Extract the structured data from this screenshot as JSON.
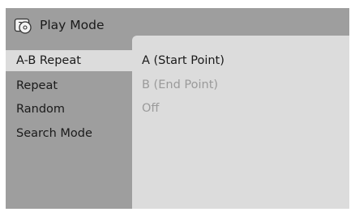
{
  "header": {
    "title": "Play Mode",
    "icon": "disc-icon"
  },
  "sidebar": {
    "items": [
      {
        "label": "A-B Repeat",
        "selected": true
      },
      {
        "label": "Repeat",
        "selected": false
      },
      {
        "label": "Random",
        "selected": false
      },
      {
        "label": "Search Mode",
        "selected": false
      }
    ]
  },
  "options": {
    "items": [
      {
        "label": "A (Start Point)",
        "enabled": true
      },
      {
        "label": "B (End Point)",
        "enabled": false
      },
      {
        "label": "Off",
        "enabled": false
      }
    ]
  },
  "colors": {
    "panel": "#9e9e9e",
    "content": "#dcdcdc",
    "text": "#1a1a1a",
    "dim_text": "#9a9a9a"
  }
}
